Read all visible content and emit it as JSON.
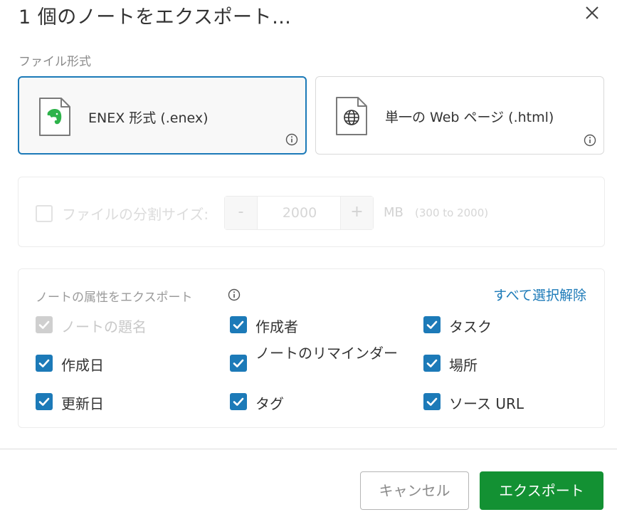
{
  "dialog": {
    "title": "1 個のノートをエクスポート…"
  },
  "file_format": {
    "label": "ファイル形式",
    "options": [
      {
        "label": "ENEX 形式 (.enex)",
        "icon": "evernote-file-icon",
        "selected": true
      },
      {
        "label": "単一の Web ページ (.html)",
        "icon": "globe-file-icon",
        "selected": false
      }
    ]
  },
  "split": {
    "label": "ファイルの分割サイズ:",
    "minus": "-",
    "value": "2000",
    "plus": "+",
    "unit": "MB",
    "range": "(300 to 2000)"
  },
  "attributes": {
    "heading": "ノートの属性をエクスポート",
    "deselect_all": "すべて選択解除",
    "items": [
      {
        "label": "ノートの題名",
        "checked": true,
        "disabled": true
      },
      {
        "label": "作成者",
        "checked": true,
        "disabled": false
      },
      {
        "label": "タスク",
        "checked": true,
        "disabled": false
      },
      {
        "label": "作成日",
        "checked": true,
        "disabled": false
      },
      {
        "label": "ノートのリマインダー",
        "checked": true,
        "disabled": false
      },
      {
        "label": "場所",
        "checked": true,
        "disabled": false
      },
      {
        "label": "更新日",
        "checked": true,
        "disabled": false
      },
      {
        "label": "タグ",
        "checked": true,
        "disabled": false
      },
      {
        "label": "ソース URL",
        "checked": true,
        "disabled": false
      }
    ]
  },
  "footer": {
    "cancel_label": "キャンセル",
    "export_label": "エクスポート"
  },
  "colors": {
    "accent_blue": "#1c7ab8",
    "export_green": "#139133",
    "evernote_green": "#2db34a"
  }
}
